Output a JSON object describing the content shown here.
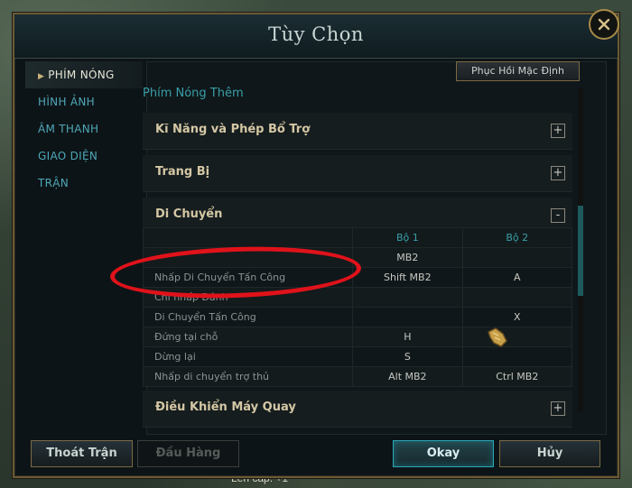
{
  "window": {
    "title": "Tùy Chọn"
  },
  "sidebar": {
    "items": [
      {
        "label": "PHÍM NÓNG",
        "active": true
      },
      {
        "label": "HÌNH ẢNH",
        "active": false
      },
      {
        "label": "ÂM THANH",
        "active": false
      },
      {
        "label": "GIAO DIỆN",
        "active": false
      },
      {
        "label": "TRẬN",
        "active": false
      }
    ]
  },
  "content": {
    "restore_defaults_label": "Phục Hồi Mặc Định",
    "subheading": "Phím Nóng Thêm",
    "sections": [
      {
        "label": "Kĩ Năng và Phép Bổ Trợ",
        "toggle": "+"
      },
      {
        "label": "Trang Bị",
        "toggle": "+"
      },
      {
        "label": "Di Chuyển",
        "toggle": "-"
      },
      {
        "label": "Điều Khiển Máy Quay",
        "toggle": "+"
      }
    ],
    "keybind_table": {
      "columns": [
        "",
        "Bộ 1",
        "Bộ 2"
      ],
      "rows": [
        {
          "name": "",
          "set1": "MB2",
          "set2": ""
        },
        {
          "name": "Nhấp Di Chuyển Tấn Công",
          "set1": "Shift  MB2",
          "set2": "A"
        },
        {
          "name": "Chỉ nhấp Đánh",
          "set1": "",
          "set2": ""
        },
        {
          "name": "Di Chuyển Tấn Công",
          "set1": "",
          "set2": "X"
        },
        {
          "name": "Đứng tại chỗ",
          "set1": "H",
          "set2": ""
        },
        {
          "name": "Dừng lại",
          "set1": "S",
          "set2": ""
        },
        {
          "name": "Nhấp di chuyển trợ thủ",
          "set1": "Alt  MB2",
          "set2": "Ctrl  MB2"
        }
      ]
    }
  },
  "footer": {
    "quit_label": "Thoát Trận",
    "surrender_label": "Đầu Hàng",
    "okay_label": "Okay",
    "cancel_label": "Hủy"
  },
  "background_text": "Lên cấp: +1",
  "colors": {
    "accent_teal": "#3a9fa8",
    "gold_border": "#7b6a44",
    "highlight_red": "#e0121a"
  }
}
